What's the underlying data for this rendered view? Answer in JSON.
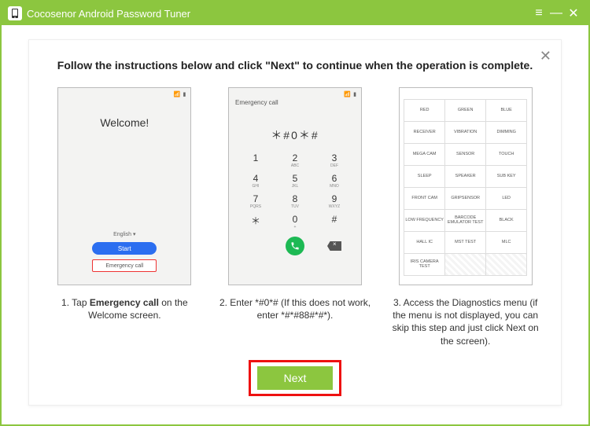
{
  "app": {
    "title": "Cocosenor Android Password Tuner"
  },
  "panel": {
    "headline": "Follow the instructions below and click \"Next\" to continue when the operation is complete."
  },
  "step1": {
    "welcome": "Welcome!",
    "lang": "English ▾",
    "start": "Start",
    "ecall": "Emergency call",
    "caption_before": "1. Tap ",
    "caption_bold": "Emergency call",
    "caption_after": " on the Welcome screen."
  },
  "step2": {
    "ecall_label": "Emergency call",
    "dial": "＊#0＊#",
    "keys": [
      {
        "n": "1",
        "s": ""
      },
      {
        "n": "2",
        "s": "ABC"
      },
      {
        "n": "3",
        "s": "DEF"
      },
      {
        "n": "4",
        "s": "GHI"
      },
      {
        "n": "5",
        "s": "JKL"
      },
      {
        "n": "6",
        "s": "MNO"
      },
      {
        "n": "7",
        "s": "PQRS"
      },
      {
        "n": "8",
        "s": "TUV"
      },
      {
        "n": "9",
        "s": "WXYZ"
      },
      {
        "n": "＊",
        "s": ""
      },
      {
        "n": "0",
        "s": "+"
      },
      {
        "n": "#",
        "s": ""
      }
    ],
    "caption": "2. Enter *#0*# (If this does not work, enter *#*#88#*#*)."
  },
  "step3": {
    "cells": [
      "RED",
      "GREEN",
      "BLUE",
      "RECEIVER",
      "VIBRATION",
      "DIMMING",
      "MEGA CAM",
      "SENSOR",
      "TOUCH",
      "SLEEP",
      "SPEAKER",
      "SUB KEY",
      "FRONT CAM",
      "GRIPSENSOR",
      "LED",
      "LOW FREQUENCY",
      "BARCODE EMULATOR TEST",
      "BLACK",
      "HALL IC",
      "MST TEST",
      "MLC",
      "IRIS CAMERA TEST",
      "",
      ""
    ],
    "caption": "3. Access the Diagnostics menu (if the menu is not displayed, you can skip this step and just click Next on the screen)."
  },
  "footer": {
    "next": "Next"
  }
}
